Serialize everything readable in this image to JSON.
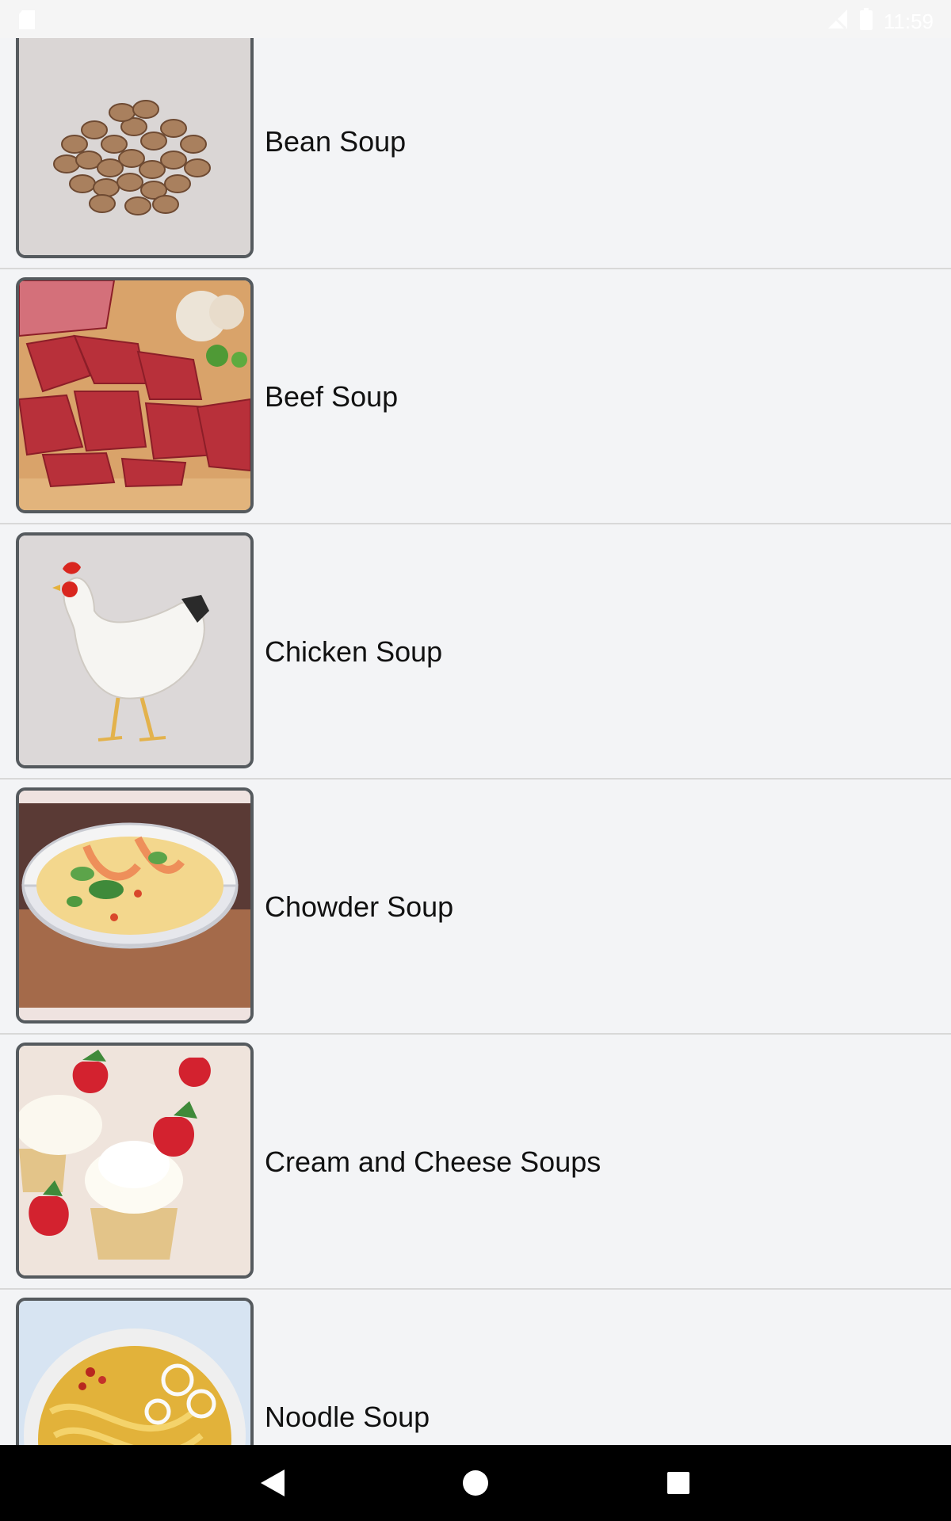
{
  "status_bar": {
    "time": "11:59",
    "icons": [
      "sd-card-icon",
      "signal-off-icon",
      "battery-icon"
    ]
  },
  "soups": [
    {
      "label": "Bean Soup",
      "image": "beans-photo"
    },
    {
      "label": "Beef Soup",
      "image": "raw-beef-photo"
    },
    {
      "label": "Chicken Soup",
      "image": "chicken-photo"
    },
    {
      "label": "Chowder Soup",
      "image": "chowder-bowl-photo"
    },
    {
      "label": "Cream and Cheese Soups",
      "image": "cupcakes-photo"
    },
    {
      "label": "Noodle Soup",
      "image": "noodle-bowl-photo"
    }
  ],
  "nav_bar": {
    "icons": [
      "back-icon",
      "home-icon",
      "recents-icon"
    ]
  },
  "colors": {
    "background": "#f3f4f6",
    "nav_bar": "#000000",
    "thumb_border": "#555a5e",
    "divider": "#d8d8d8"
  }
}
